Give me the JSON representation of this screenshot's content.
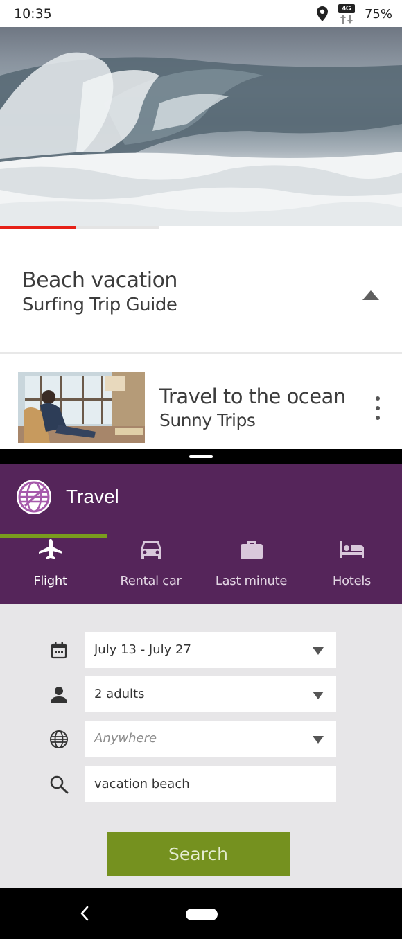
{
  "status_bar": {
    "time": "10:35",
    "network": "4G",
    "battery": "75%",
    "icons": [
      "location-icon",
      "network-4g-icon"
    ]
  },
  "video": {
    "progress_percent": 19,
    "colors": {
      "progress": "#e62117",
      "track": "#e4e4e4"
    }
  },
  "video_info": {
    "title": "Beach vacation",
    "subtitle": "Surfing Trip Guide",
    "icon": "collapse-up-icon"
  },
  "playlist": {
    "items": [
      {
        "title": "Travel to the ocean",
        "subtitle": "Sunny Trips",
        "icon": "more-vert-icon"
      }
    ]
  },
  "travel_app": {
    "title": "Travel",
    "colors": {
      "header": "#55255a",
      "accent": "#7a9c1e",
      "form_bg": "#e7e6e8"
    },
    "tabs": [
      {
        "label": "Flight",
        "icon": "airplane-icon",
        "active": true
      },
      {
        "label": "Rental car",
        "icon": "car-icon",
        "active": false
      },
      {
        "label": "Last minute",
        "icon": "suitcase-icon",
        "active": false
      },
      {
        "label": "Hotels",
        "icon": "bed-icon",
        "active": false
      }
    ],
    "form": {
      "dates": {
        "value": "July 13 - July 27",
        "icon": "calendar-icon"
      },
      "travelers": {
        "value": "2 adults",
        "icon": "person-icon"
      },
      "destination": {
        "placeholder": "Anywhere",
        "icon": "globe-icon"
      },
      "keywords": {
        "value": "vacation beach",
        "icon": "search-icon"
      },
      "search_label": "Search"
    }
  },
  "nav_bar": {
    "icons": [
      "back-icon",
      "home-icon"
    ]
  }
}
